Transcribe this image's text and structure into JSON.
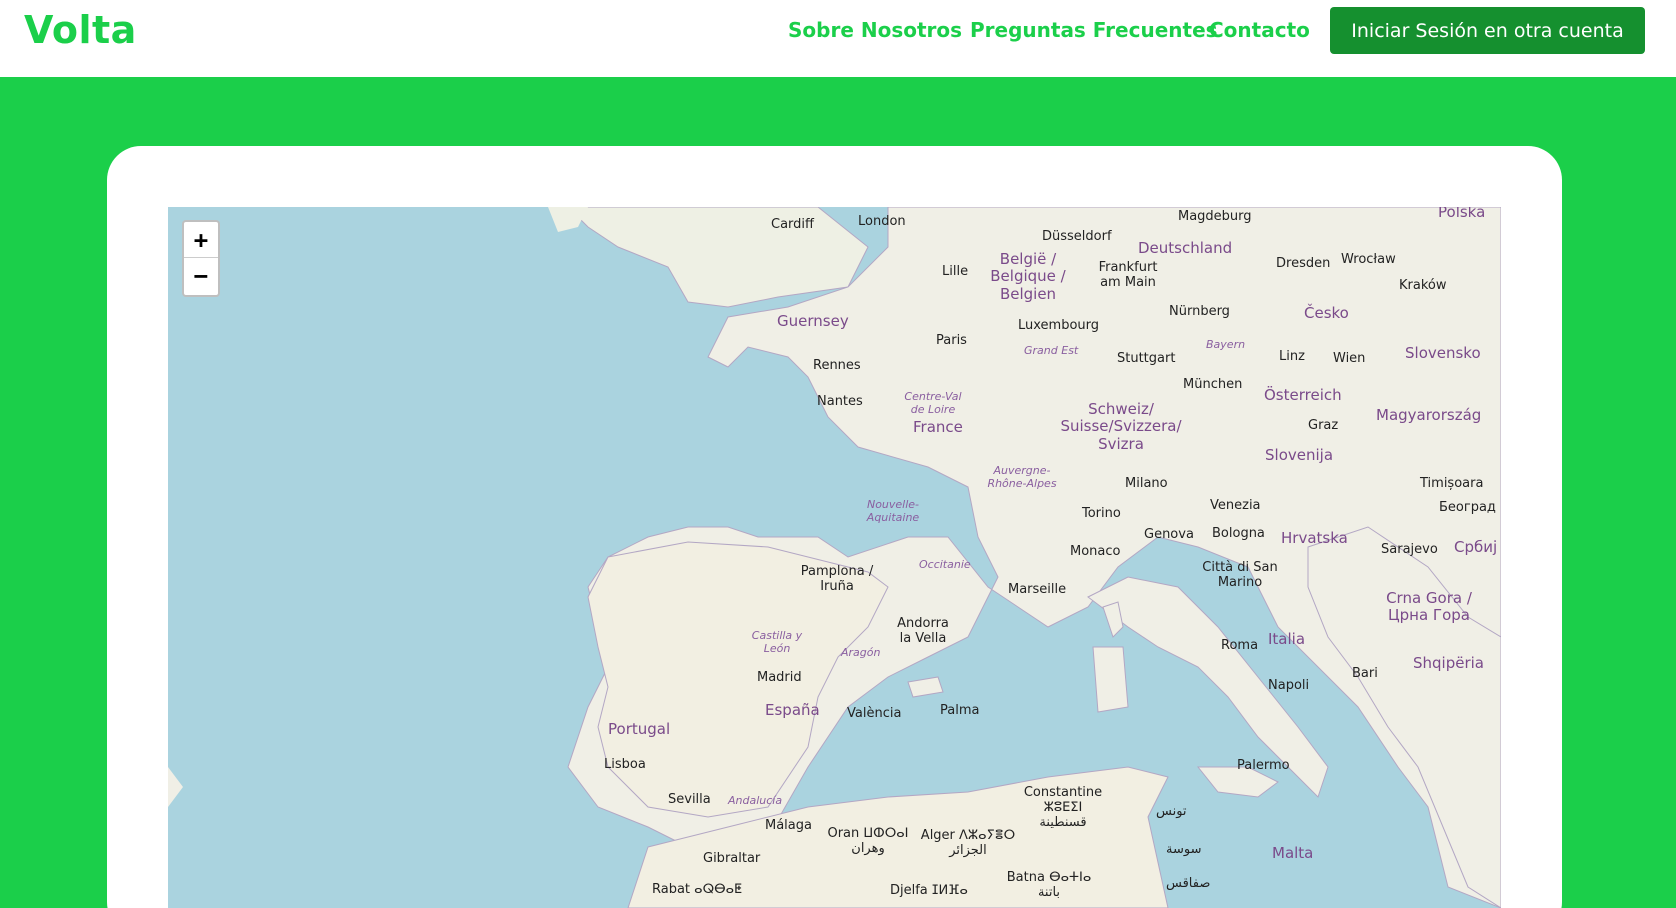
{
  "brand": "Volta",
  "nav": {
    "about": "Sobre Nosotros",
    "faq": "Preguntas Frecuentes",
    "contact": "Contacto",
    "login": "Iniciar Sesión en otra cuenta"
  },
  "map": {
    "zoom_in": "+",
    "zoom_out": "−",
    "labels": [
      "Cardiff",
      "London",
      "Düsseldorf",
      "Magdeburg",
      "Polska",
      "Deutschland",
      "België / Belgique / Belgien",
      "Frankfurt am Main",
      "Dresden",
      "Wrocław",
      "Lille",
      "Kraków",
      "Guernsey",
      "Luxembourg",
      "Nürnberg",
      "Česko",
      "Paris",
      "Grand Est",
      "Bayern",
      "Rennes",
      "Stuttgart",
      "Linz",
      "Wien",
      "Slovensko",
      "Centre-Val de Loire",
      "München",
      "Nantes",
      "Österreich",
      "Schweiz/ Suisse/Svizzera/ Svizra",
      "France",
      "Magyarország",
      "Graz",
      "Slovenija",
      "Auvergne- Rhône-Alpes",
      "Milano",
      "Timișoara",
      "Nouvelle- Aquitaine",
      "Venezia",
      "Београд",
      "Torino",
      "Bologna",
      "Hrvatska",
      "Genova",
      "Monaco",
      "Sarajevo",
      "Србиј",
      "Occitanie",
      "Pamplona / Iruña",
      "Città di San Marino",
      "Marseille",
      "Crna Gora / Црна Гора",
      "Andorra la Vella",
      "Castilla y León",
      "Aragón",
      "Roma",
      "Italia",
      "Shqipëria",
      "Madrid",
      "Bari",
      "España",
      "Palma",
      "València",
      "Napoli",
      "Portugal",
      "Lisboa",
      "Palermo",
      "Sevilla",
      "Andalucía",
      "Constantine ⵣⵓⴹⵉⵏ قسنطينة",
      "تونس",
      "Málaga",
      "Oran ⵡⵀⵔⴰⵏ وهران",
      "Alger ⴷⵣⴰⵢⴻⵔ الجزائر",
      "سوسة",
      "Gibraltar",
      "Malta",
      "Rabat ⴰⵕⴱⴰⵟ",
      "Djelfa ⵊⵍⴼⴰ",
      "Batna ⴱⴰⵜⵏⴰ باتنة",
      "صفاقس"
    ]
  }
}
